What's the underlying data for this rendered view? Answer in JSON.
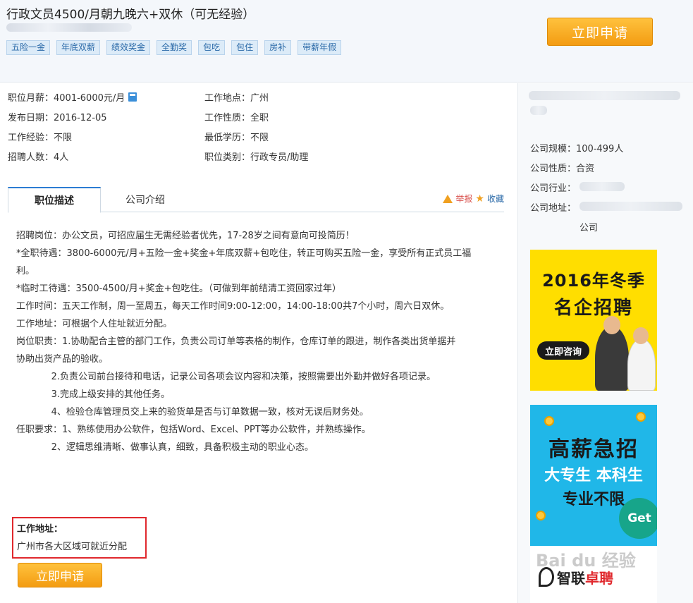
{
  "header": {
    "job_title": "行政文员4500/月朝九晚六+双休（可无经验）",
    "tags": [
      "五险一金",
      "年底双薪",
      "绩效奖金",
      "全勤奖",
      "包吃",
      "包住",
      "房补",
      "带薪年假"
    ],
    "apply_label": "立即申请"
  },
  "job_info": {
    "salary": "职位月薪：4001-6000元/月",
    "location": "工作地点：广州",
    "publish_date": "发布日期：2016-12-05",
    "job_nature": "工作性质：全职",
    "experience": "工作经验：不限",
    "education": "最低学历：不限",
    "headcount": "招聘人数：4人",
    "category": "职位类别：行政专员/助理"
  },
  "tabs": {
    "description": "职位描述",
    "company": "公司介绍",
    "report": "举报",
    "favorite": "收藏"
  },
  "description_lines": [
    "招聘岗位：办公文员，可招应届生无需经验者优先，17-28岁之间有意向可投简历！",
    "",
    "*全职待遇：3800-6000元/月+五险一金+奖金+年底双薪+包吃住，转正可购买五险一金，享受所有正式员工福",
    "利。",
    "*临时工待遇：3500-4500/月+奖金+包吃住。（可做到年前结清工资回家过年）",
    "",
    "工作时间：五天工作制，周一至周五，每天工作时间9:00-12:00，14:00-18:00共7个小时，周六日双休。",
    "工作地址：可根据个人住址就近分配。",
    "",
    "岗位职责：1.协助配合主管的部门工作，负责公司订单等表格的制作，仓库订单的跟进，制作各类出货单据并",
    "协助出货产品的验收。",
    "            2.负责公司前台接待和电话，记录公司各项会议内容和决策，按照需要出外勤并做好各项记录。",
    "            3.完成上级安排的其他任务。",
    "            4、检验仓库管理员交上来的验货单是否与订单数据一致，核对无误后财务处。",
    "任职要求：1、熟练使用办公软件，包括Word、Excel、PPT等办公软件，并熟练操作。",
    "            2、逻辑思维清晰、做事认真，细致，具备积极主动的职业心态。"
  ],
  "address_box": {
    "title": "工作地址：",
    "text": "广州市各大区域可就近分配"
  },
  "apply_bottom_label": "立即申请",
  "sidebar": {
    "scale": "公司规模：100-499人",
    "nature": "公司性质：合资",
    "industry": "公司行业：",
    "address": "公司地址：",
    "address_tail": "公司"
  },
  "ads": {
    "ad1_line1": "2016年冬季",
    "ad1_line2": "名企招聘",
    "ad1_button": "立即咨询",
    "ad2_line1": "高薪急招",
    "ad2_line2": "大专生 本科生",
    "ad2_line3": "专业不限",
    "ad2_get": "Get",
    "ad2_logo_a": "智联",
    "ad2_logo_b": "卓聘"
  },
  "watermark": "Bai du 经验",
  "colors": {
    "accent_orange": "#f39c12",
    "tag_blue": "#2b6aa8",
    "highlight_red": "#e0282d",
    "ad_yellow": "#ffde00",
    "ad_blue": "#20b7e8"
  }
}
